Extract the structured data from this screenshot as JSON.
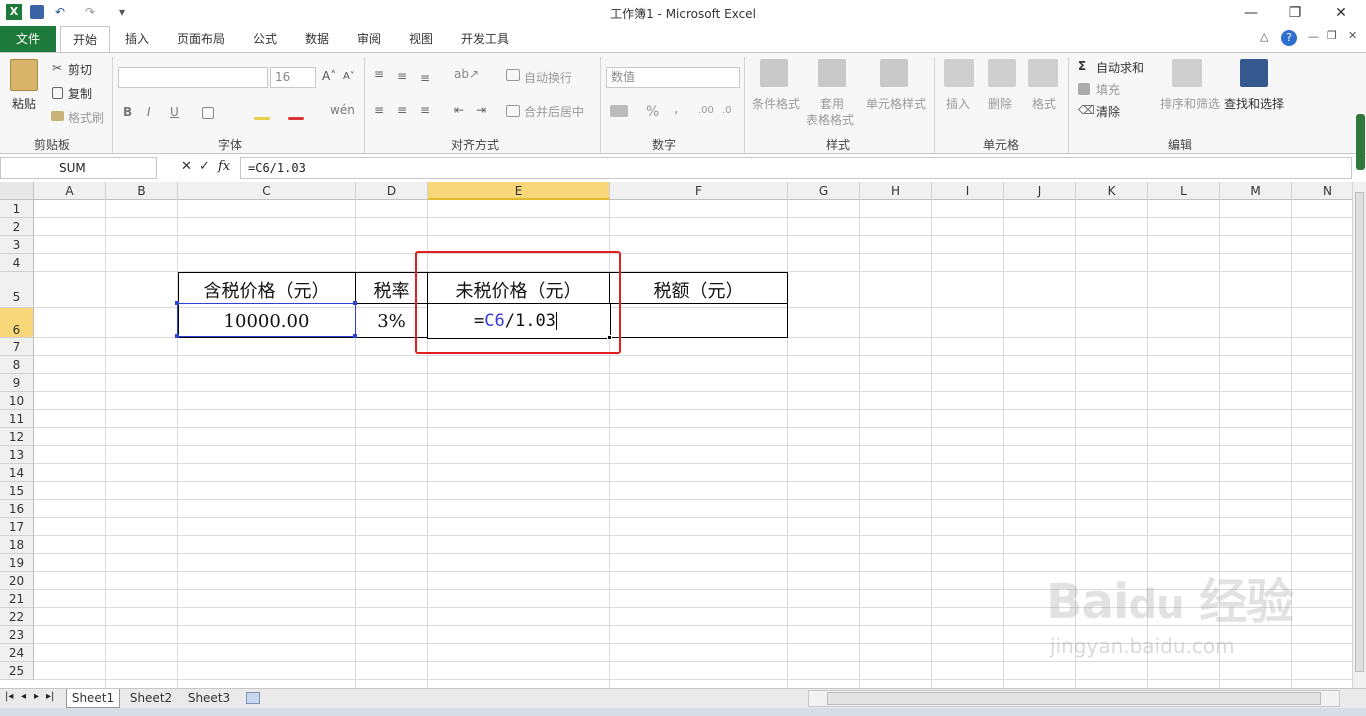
{
  "window": {
    "title": "工作簿1 - Microsoft Excel"
  },
  "qat": {
    "undo": "↶",
    "redo": "↷"
  },
  "tabs": [
    {
      "label": "文件"
    },
    {
      "label": "开始"
    },
    {
      "label": "插入"
    },
    {
      "label": "页面布局"
    },
    {
      "label": "公式"
    },
    {
      "label": "数据"
    },
    {
      "label": "审阅"
    },
    {
      "label": "视图"
    },
    {
      "label": "开发工具"
    }
  ],
  "ribbon": {
    "clipboard": {
      "paste": "粘贴",
      "cut": "剪切",
      "copy": "复制",
      "format_painter": "格式刷",
      "group": "剪贴板"
    },
    "font": {
      "font_name": "",
      "font_size": "16",
      "bold": "B",
      "italic": "I",
      "underline": "U",
      "group": "字体"
    },
    "alignment": {
      "wrap": "自动换行",
      "merge": "合并后居中",
      "group": "对齐方式"
    },
    "number": {
      "format": "数值",
      "percent": "%",
      "comma": ",",
      "group": "数字"
    },
    "styles": {
      "conditional": "条件格式",
      "table1": "套用",
      "table2": "表格格式",
      "cell_styles": "单元格样式",
      "group": "样式"
    },
    "cells": {
      "insert": "插入",
      "delete": "删除",
      "format": "格式",
      "group": "单元格"
    },
    "editing": {
      "autosum": "自动求和",
      "fill": "填充",
      "clear": "清除",
      "sort": "排序和筛选",
      "find": "查找和选择",
      "group": "编辑"
    }
  },
  "formula_bar": {
    "name_box": "SUM",
    "fx": "fx",
    "formula": "=C6/1.03"
  },
  "columns": [
    "A",
    "B",
    "C",
    "D",
    "E",
    "F",
    "G",
    "H",
    "I",
    "J",
    "K",
    "L",
    "M",
    "N"
  ],
  "rows": [
    "1",
    "2",
    "3",
    "4",
    "5",
    "6",
    "7",
    "8",
    "9",
    "10",
    "11",
    "12",
    "13",
    "14",
    "15",
    "16",
    "17",
    "18",
    "19",
    "20",
    "21",
    "22",
    "23",
    "24",
    "25"
  ],
  "table": {
    "headers": [
      "含税价格（元）",
      "税率",
      "未税价格（元）",
      "税额（元）"
    ],
    "values": [
      "10000.00",
      "3%",
      "",
      ""
    ],
    "edit": {
      "eq": "=",
      "ref": "C6",
      "rest": "/1.03"
    }
  },
  "sheets": [
    "Sheet1",
    "Sheet2",
    "Sheet3"
  ],
  "colors": {
    "accent": "#1e7a3a",
    "highlight_box": "#e02020",
    "ref_blue": "#3a3adf"
  }
}
